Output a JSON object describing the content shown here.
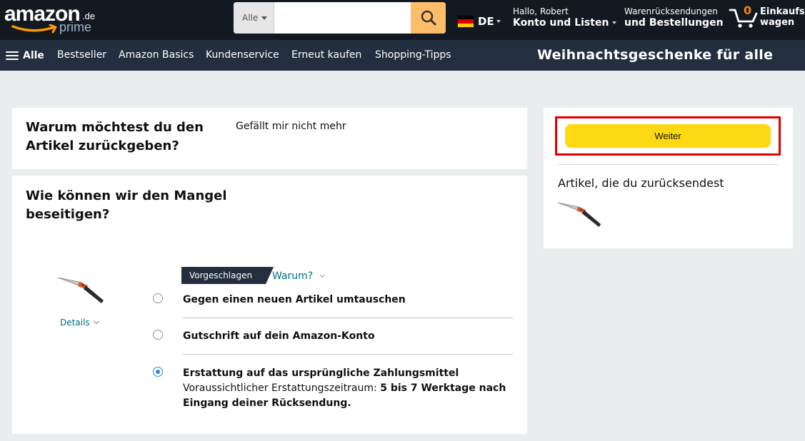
{
  "header": {
    "logo": {
      "word": "amazon",
      "tld": ".de",
      "sub": "prime"
    },
    "search": {
      "department": "Alle",
      "value": "",
      "placeholder": ""
    },
    "language": "DE",
    "account": {
      "line1": "Hallo, Robert",
      "line2": "Konto und Listen"
    },
    "returns": {
      "line1": "Warenrücksendungen",
      "line2": "und Bestellungen"
    },
    "cart": {
      "count": "0",
      "line1": "Einkaufs-",
      "line2": "wagen"
    }
  },
  "navbar": {
    "all": "Alle",
    "items": [
      "Bestseller",
      "Amazon Basics",
      "Kundenservice",
      "Erneut kaufen",
      "Shopping-Tipps"
    ],
    "promo": "Weihnachtsgeschenke für alle"
  },
  "reason": {
    "question_line1": "Warum möchtest du den",
    "question_line2": "Artikel zurückgeben?",
    "answer": "Gefällt mir nicht mehr"
  },
  "resolution": {
    "question_line1": "Wie können wir den Mangel",
    "question_line2": "beseitigen?",
    "details_link": "Details",
    "suggested_badge": "Vorgeschlagen",
    "why_link": "Warum?",
    "options": [
      {
        "label": "Gegen einen neuen Artikel umtauschen",
        "selected": false
      },
      {
        "label": "Gutschrift auf dein Amazon-Konto",
        "selected": false
      },
      {
        "label": "Erstattung auf das ursprüngliche Zahlungsmittel",
        "selected": true,
        "sub_prefix": "Voraussichtlicher Erstattungszeitraum: ",
        "sub_bold": "5 bis 7 Werktage nach Eingang deiner Rücksendung."
      }
    ]
  },
  "sidebar": {
    "continue_button": "Weiter",
    "items_title": "Artikel, die du zurücksendest"
  },
  "colors": {
    "header_bg": "#131921",
    "nav_bg": "#232f3e",
    "search_button": "#febd69",
    "cart_count": "#f08804",
    "continue_button": "#ffd814",
    "highlight_border": "#e00000",
    "link": "#007185",
    "radio_selected": "#2e86d6"
  }
}
